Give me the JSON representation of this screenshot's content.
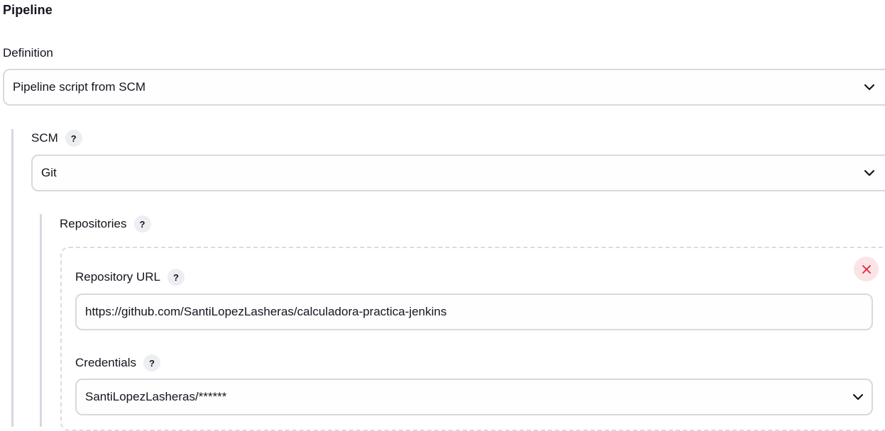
{
  "pipeline": {
    "title": "Pipeline",
    "definition": {
      "label": "Definition",
      "value": "Pipeline script from SCM"
    },
    "scm": {
      "label": "SCM",
      "help": "?",
      "value": "Git"
    },
    "repositories": {
      "label": "Repositories",
      "help": "?",
      "repository_url": {
        "label": "Repository URL",
        "help": "?",
        "value": "https://github.com/SantiLopezLasheras/calculadora-practica-jenkins"
      },
      "credentials": {
        "label": "Credentials",
        "help": "?",
        "value": "SantiLopezLasheras/******"
      },
      "delete_icon": "close-icon"
    }
  },
  "colors": {
    "border": "#d7d9e0",
    "help_bg": "#eceef2",
    "nest_bar": "#d4d8e2",
    "delete_bg": "#fbe4e6",
    "delete_fg": "#e0263b"
  }
}
